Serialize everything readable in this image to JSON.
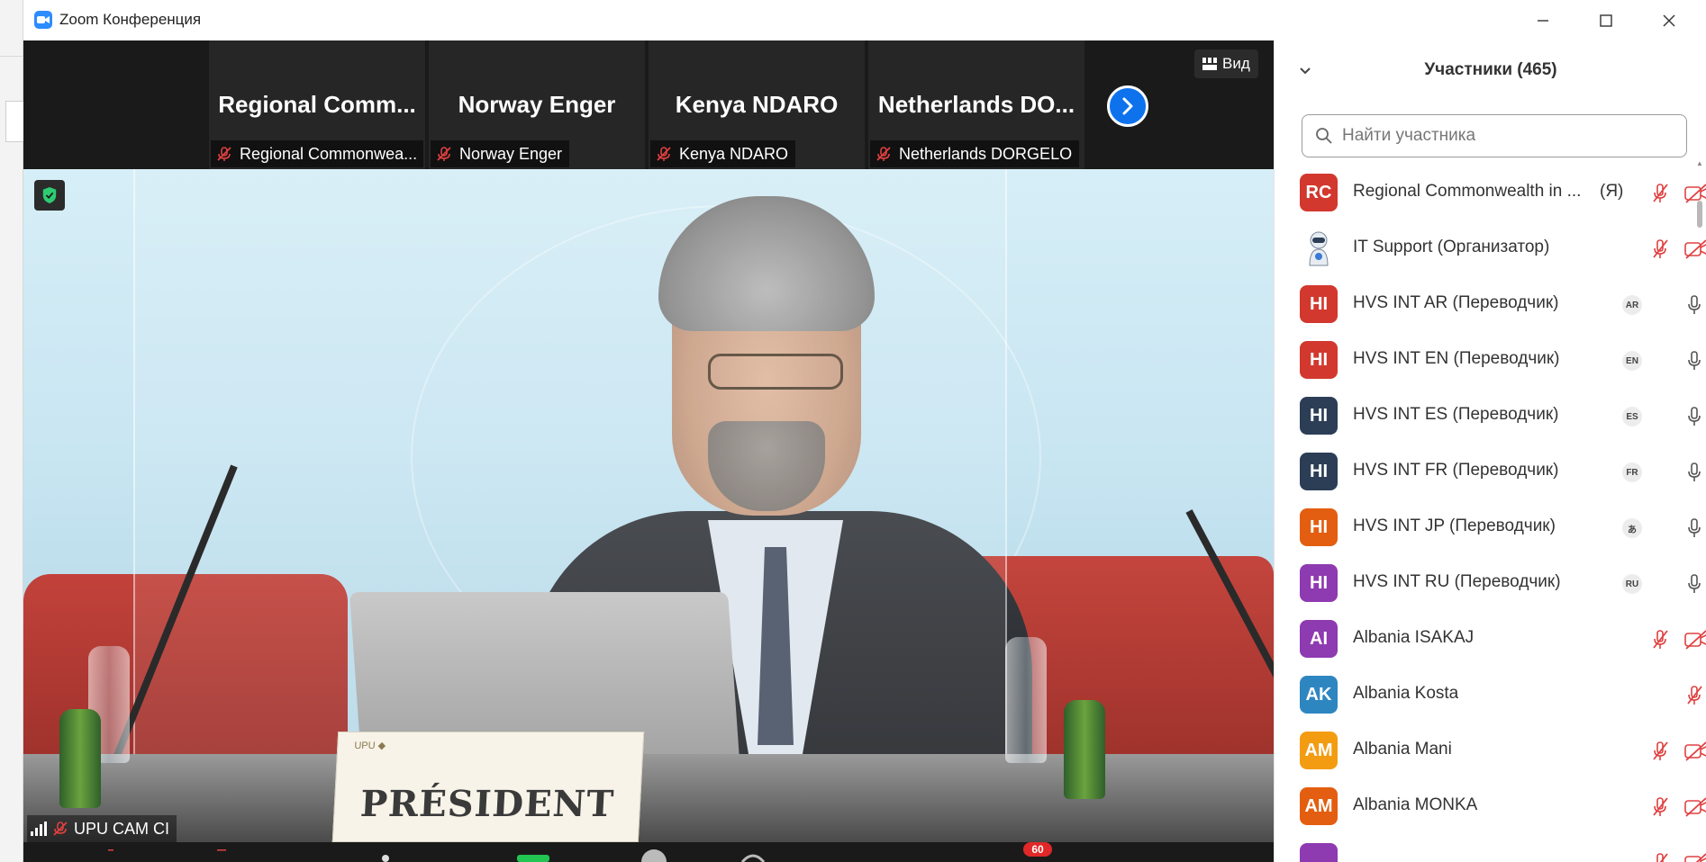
{
  "window": {
    "title": "Zoom Конференция",
    "minimize_icon": "minimize-icon",
    "maximize_icon": "maximize-icon",
    "close_icon": "close-icon"
  },
  "view_button": {
    "label": "Вид",
    "icon": "grid-icon"
  },
  "thumbnails": [
    {
      "display_name": "Regional  Comm...",
      "label": "Regional Commonwea..."
    },
    {
      "display_name": "Norway Enger",
      "label": "Norway Enger"
    },
    {
      "display_name": "Kenya NDARO",
      "label": "Kenya NDARO"
    },
    {
      "display_name": "Netherlands  DO...",
      "label": "Netherlands DORGELO"
    }
  ],
  "main_video": {
    "speaker_label": "UPU CAM CI",
    "nameplate_text": "PRÉSIDENT"
  },
  "toolbar": {
    "chat_badge": "60"
  },
  "participants": {
    "title": "Участники (465)",
    "search_placeholder": "Найти участника",
    "list": [
      {
        "initials": "RC",
        "name": "Regional Commonwealth in ...",
        "suffix": "(Я)",
        "color": "#d2382e",
        "lang": "",
        "mic": "muted",
        "video": "off"
      },
      {
        "initials": "",
        "name": "IT Support (Организатор)",
        "suffix": "",
        "color": "#ffffff",
        "lang": "",
        "mic": "muted",
        "video": "off",
        "robot": true
      },
      {
        "initials": "HI",
        "name": "HVS INT AR (Переводчик)",
        "suffix": "",
        "color": "#d2382e",
        "lang": "AR",
        "mic": "on",
        "video": "none"
      },
      {
        "initials": "HI",
        "name": "HVS INT EN (Переводчик)",
        "suffix": "",
        "color": "#d2382e",
        "lang": "EN",
        "mic": "on",
        "video": "none"
      },
      {
        "initials": "HI",
        "name": "HVS INT ES (Переводчик)",
        "suffix": "",
        "color": "#2c3e56",
        "lang": "ES",
        "mic": "on",
        "video": "none"
      },
      {
        "initials": "HI",
        "name": "HVS INT FR (Переводчик)",
        "suffix": "",
        "color": "#2c3e56",
        "lang": "FR",
        "mic": "on",
        "video": "none"
      },
      {
        "initials": "HI",
        "name": "HVS INT JP (Переводчик)",
        "suffix": "",
        "color": "#e35e10",
        "lang": "あ",
        "mic": "on",
        "video": "none"
      },
      {
        "initials": "HI",
        "name": "HVS INT RU (Переводчик)",
        "suffix": "",
        "color": "#8e3ab0",
        "lang": "RU",
        "mic": "on",
        "video": "none"
      },
      {
        "initials": "AI",
        "name": "Albania ISAKAJ",
        "suffix": "",
        "color": "#8e3ab0",
        "lang": "",
        "mic": "muted",
        "video": "off"
      },
      {
        "initials": "AK",
        "name": "Albania Kosta",
        "suffix": "",
        "color": "#2e86c1",
        "lang": "",
        "mic": "muted-only",
        "video": "none"
      },
      {
        "initials": "AM",
        "name": "Albania Mani",
        "suffix": "",
        "color": "#f39c12",
        "lang": "",
        "mic": "muted",
        "video": "off"
      },
      {
        "initials": "AM",
        "name": "Albania MONKA",
        "suffix": "",
        "color": "#e35e10",
        "lang": "",
        "mic": "muted",
        "video": "off"
      },
      {
        "initials": "",
        "name": "",
        "suffix": "",
        "color": "#8e3ab0",
        "lang": "",
        "mic": "muted",
        "video": "off"
      }
    ]
  }
}
